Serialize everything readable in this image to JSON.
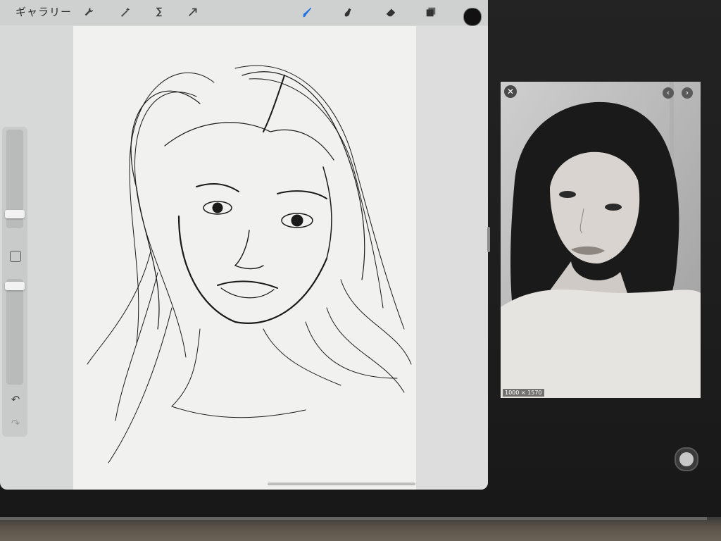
{
  "app": {
    "gallery_label": "ギャラリー"
  },
  "toolbar": {
    "left_tools": [
      {
        "name": "actions",
        "icon": "wrench-icon"
      },
      {
        "name": "adjustments",
        "icon": "magic-wand-icon"
      },
      {
        "name": "selection",
        "icon": "selection-s-icon"
      },
      {
        "name": "transform",
        "icon": "arrow-cursor-icon"
      }
    ],
    "right_tools": [
      {
        "name": "brush",
        "icon": "brush-icon",
        "active": true
      },
      {
        "name": "smudge",
        "icon": "smudge-icon"
      },
      {
        "name": "eraser",
        "icon": "eraser-icon"
      },
      {
        "name": "layers",
        "icon": "layers-icon"
      }
    ],
    "current_color": "#111111",
    "active_color": "#1f6fe0"
  },
  "sidebar": {
    "brush_size": 0.2,
    "opacity": 0.95
  },
  "reference": {
    "dimensions": "1000 × 1570",
    "close_icon": "close-icon",
    "prev_icon": "chevron-left-icon",
    "next_icon": "chevron-right-icon"
  }
}
